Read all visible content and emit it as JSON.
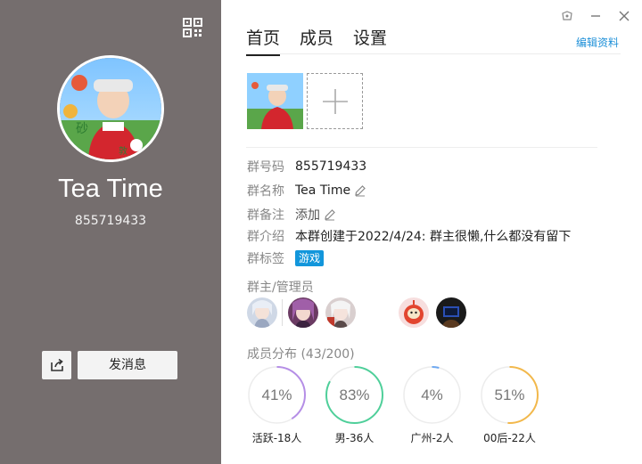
{
  "left": {
    "group_name": "Tea Time",
    "group_id": "855719433",
    "send_message_label": "发消息"
  },
  "tabs": [
    {
      "label": "首页",
      "active": true
    },
    {
      "label": "成员",
      "active": false
    },
    {
      "label": "设置",
      "active": false
    }
  ],
  "edit_profile_label": "编辑资料",
  "info": {
    "group_number_label": "群号码",
    "group_number": "855719433",
    "group_name_label": "群名称",
    "group_name": "Tea Time",
    "remark_label": "群备注",
    "remark_add": "添加",
    "intro_label": "群介绍",
    "intro": "本群创建于2022/4/24:  群主很懒,什么都没有留下",
    "tag_label": "群标签",
    "tag": "游戏"
  },
  "admins_title": "群主/管理员",
  "member_dist_title": "成员分布 (43/200)",
  "stats": [
    {
      "pct": "41%",
      "value": 0.41,
      "label": "活跃-18人",
      "color": "#b58ee6"
    },
    {
      "pct": "83%",
      "value": 0.83,
      "label": "男-36人",
      "color": "#4fcf9a"
    },
    {
      "pct": "4%",
      "value": 0.04,
      "label": "广州-2人",
      "color": "#6ea8f0"
    },
    {
      "pct": "51%",
      "value": 0.51,
      "label": "00后-22人",
      "color": "#f2b84b"
    }
  ],
  "colors": {
    "left_panel": "#756e6e",
    "link": "#1e90d8",
    "tag": "#1296db"
  }
}
